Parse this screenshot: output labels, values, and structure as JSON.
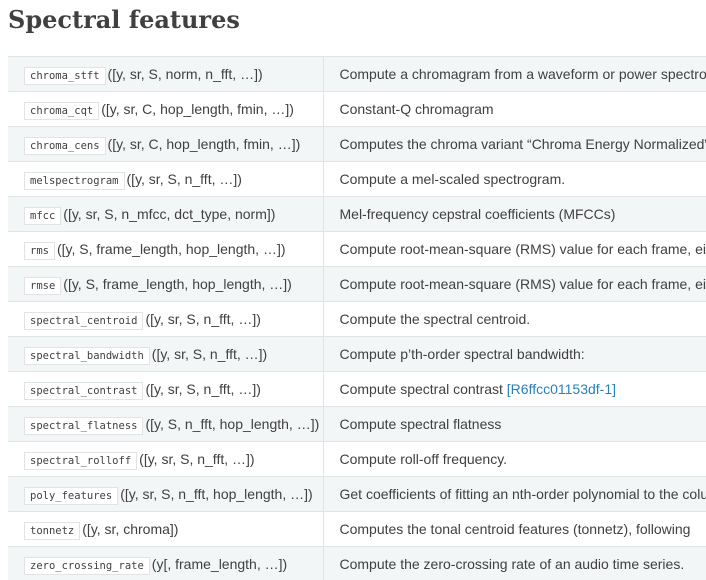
{
  "section": {
    "title": "Spectral features"
  },
  "rows": [
    {
      "name": "chroma_stft",
      "sig": "([y, sr, S, norm, n_fft, …])",
      "desc": "Compute a chromagram from a waveform or power spectrogram.",
      "ref": ""
    },
    {
      "name": "chroma_cqt",
      "sig": "([y, sr, C, hop_length, fmin, …])",
      "desc": "Constant-Q chromagram",
      "ref": ""
    },
    {
      "name": "chroma_cens",
      "sig": "([y, sr, C, hop_length, fmin, …])",
      "desc": "Computes the chroma variant “Chroma Energy Normalized”",
      "ref": ""
    },
    {
      "name": "melspectrogram",
      "sig": "([y, sr, S, n_fft, …])",
      "desc": "Compute a mel-scaled spectrogram.",
      "ref": ""
    },
    {
      "name": "mfcc",
      "sig": "([y, sr, S, n_mfcc, dct_type, norm])",
      "desc": "Mel-frequency cepstral coefficients (MFCCs)",
      "ref": ""
    },
    {
      "name": "rms",
      "sig": "([y, S, frame_length, hop_length, …])",
      "desc": "Compute root-mean-square (RMS) value for each frame, either",
      "ref": ""
    },
    {
      "name": "rmse",
      "sig": "([y, S, frame_length, hop_length, …])",
      "desc": "Compute root-mean-square (RMS) value for each frame, either",
      "ref": ""
    },
    {
      "name": "spectral_centroid",
      "sig": "([y, sr, S, n_fft, …])",
      "desc": "Compute the spectral centroid.",
      "ref": ""
    },
    {
      "name": "spectral_bandwidth",
      "sig": "([y, sr, S, n_fft, …])",
      "desc": "Compute p’th-order spectral bandwidth:",
      "ref": ""
    },
    {
      "name": "spectral_contrast",
      "sig": "([y, sr, S, n_fft, …])",
      "desc": "Compute spectral contrast ",
      "ref": "[R6ffcc01153df-1]"
    },
    {
      "name": "spectral_flatness",
      "sig": "([y, S, n_fft, hop_length, …])",
      "desc": "Compute spectral flatness",
      "ref": ""
    },
    {
      "name": "spectral_rolloff",
      "sig": "([y, sr, S, n_fft, …])",
      "desc": "Compute roll-off frequency.",
      "ref": ""
    },
    {
      "name": "poly_features",
      "sig": "([y, sr, S, n_fft, hop_length, …])",
      "desc": "Get coefficients of fitting an nth-order polynomial to the columns",
      "ref": ""
    },
    {
      "name": "tonnetz",
      "sig": "([y, sr, chroma])",
      "desc": "Computes the tonal centroid features (tonnetz), following",
      "ref": ""
    },
    {
      "name": "zero_crossing_rate",
      "sig": "(y[, frame_length, …])",
      "desc": "Compute the zero-crossing rate of an audio time series.",
      "ref": ""
    }
  ]
}
